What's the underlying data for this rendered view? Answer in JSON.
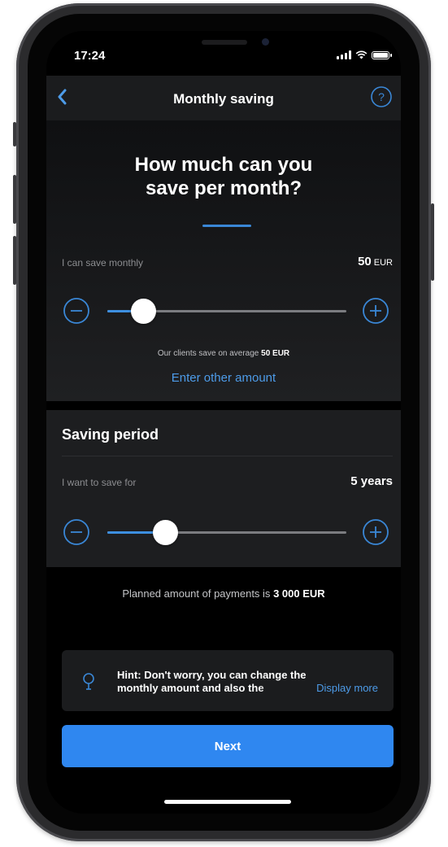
{
  "status_bar": {
    "time": "17:24"
  },
  "nav": {
    "title": "Monthly saving"
  },
  "question": {
    "line1": "How much can you",
    "line2": "save per month?"
  },
  "monthly": {
    "label": "I can save monthly",
    "value": "50",
    "unit": "EUR",
    "slider_fraction": 0.15,
    "avg_prefix": "Our clients save on average",
    "avg_value": "50 EUR",
    "other_amount_link": "Enter other amount"
  },
  "period": {
    "title": "Saving period",
    "label": "I want to save for",
    "value": "5 years",
    "slider_fraction": 0.24
  },
  "planned": {
    "prefix": "Planned amount of payments is",
    "amount": "3 000 EUR"
  },
  "hint": {
    "line1": "Hint: Don't worry, you can change the",
    "line2": "monthly amount and also the",
    "display_more": "Display more"
  },
  "next_button": "Next",
  "colors": {
    "accent": "#2f87f0",
    "link": "#4d9be8",
    "background": "#000000",
    "card": "#1d1e20"
  }
}
